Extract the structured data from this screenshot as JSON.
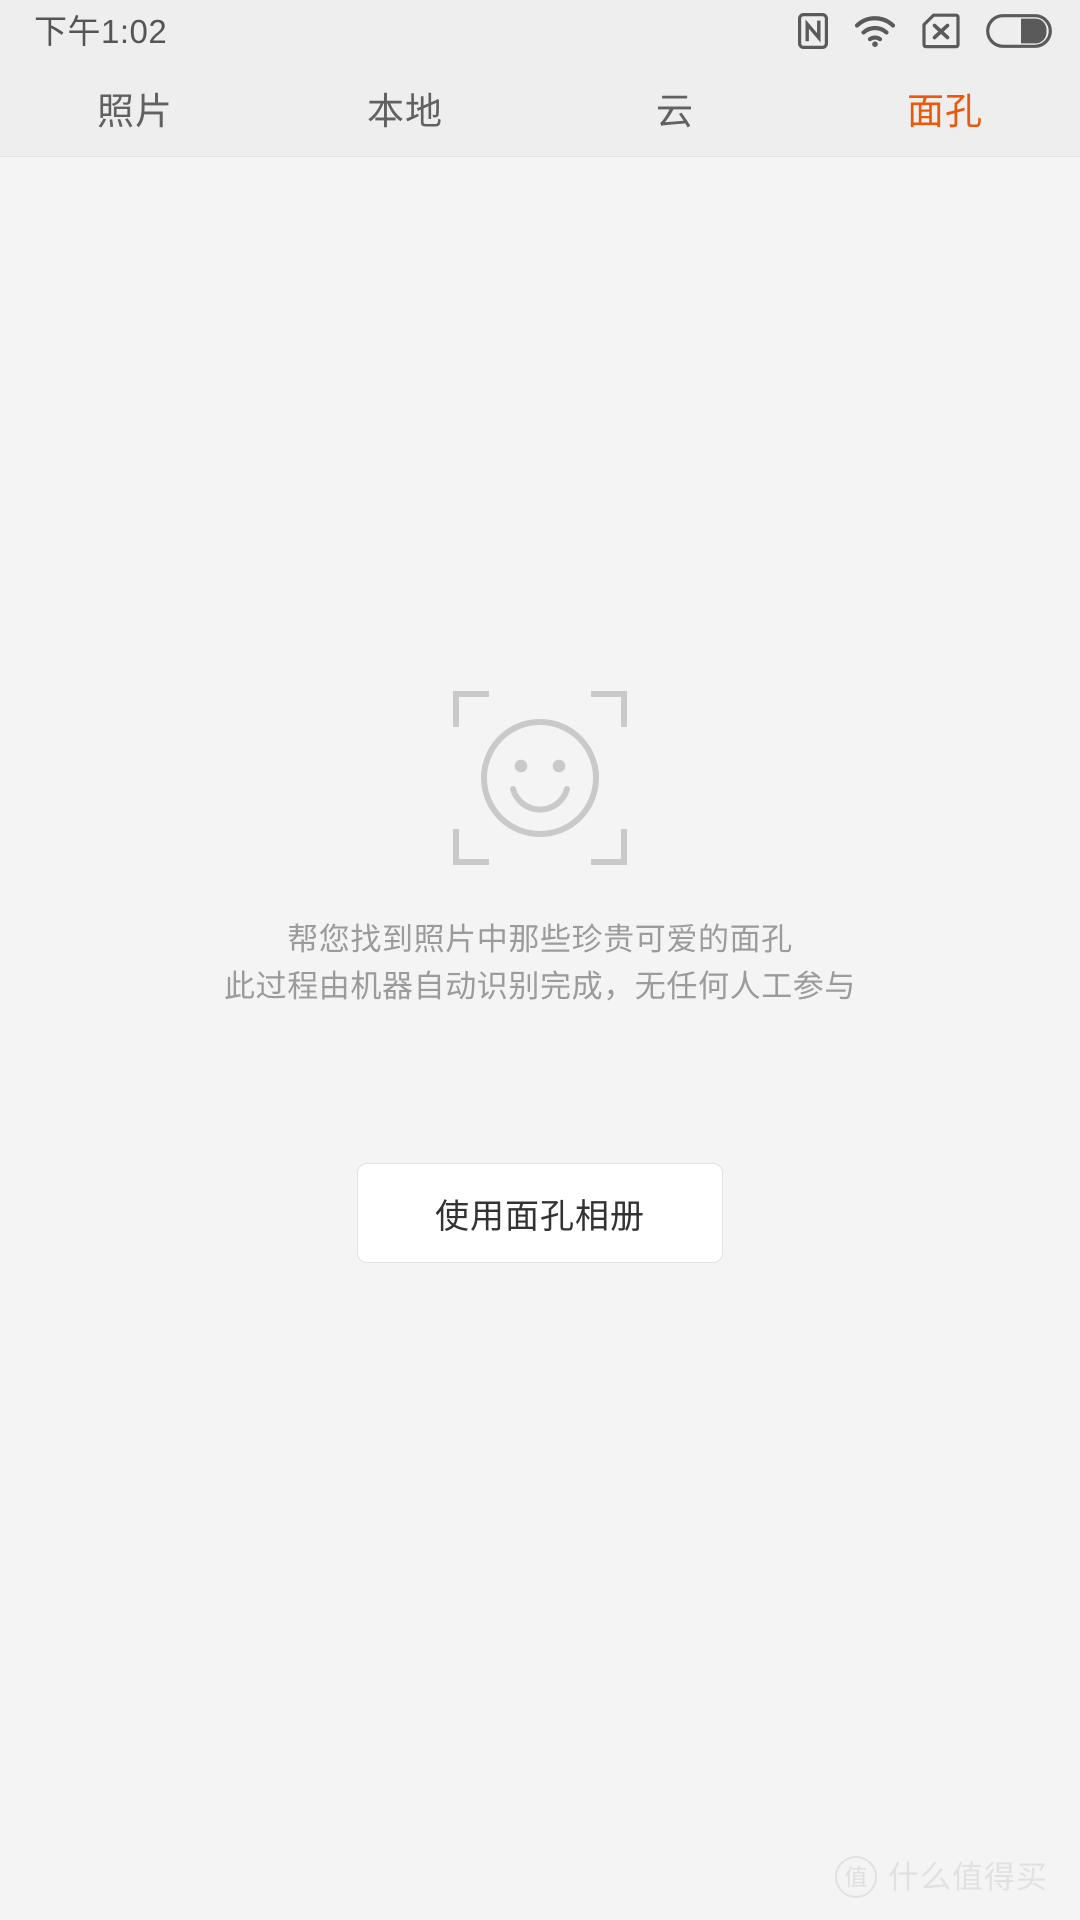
{
  "status_bar": {
    "clock": "下午1:02",
    "icons": [
      {
        "name": "nfc-icon",
        "label": "NFC"
      },
      {
        "name": "wifi-icon",
        "label": "WiFi"
      },
      {
        "name": "no-sim-icon",
        "label": "No SIM"
      },
      {
        "name": "battery-icon",
        "label": "Battery"
      }
    ]
  },
  "tabs": [
    {
      "label": "照片",
      "active": false
    },
    {
      "label": "本地",
      "active": false
    },
    {
      "label": "云",
      "active": false
    },
    {
      "label": "面孔",
      "active": true
    }
  ],
  "empty_state": {
    "icon_name": "face-scan-icon",
    "hint_lines": [
      "帮您找到照片中那些珍贵可爱的面孔",
      "此过程由机器自动识别完成，无任何人工参与"
    ],
    "button_label": "使用面孔相册"
  },
  "watermark": {
    "badge": "值",
    "text": "什么值得买"
  },
  "colors": {
    "accent": "#e8590c",
    "status_bar_bg": "#eeeeee",
    "page_bg": "#f4f4f4",
    "tab_inactive": "#616161",
    "hint_text": "#9b9b9b",
    "icon_gray": "#c9c9c9"
  }
}
